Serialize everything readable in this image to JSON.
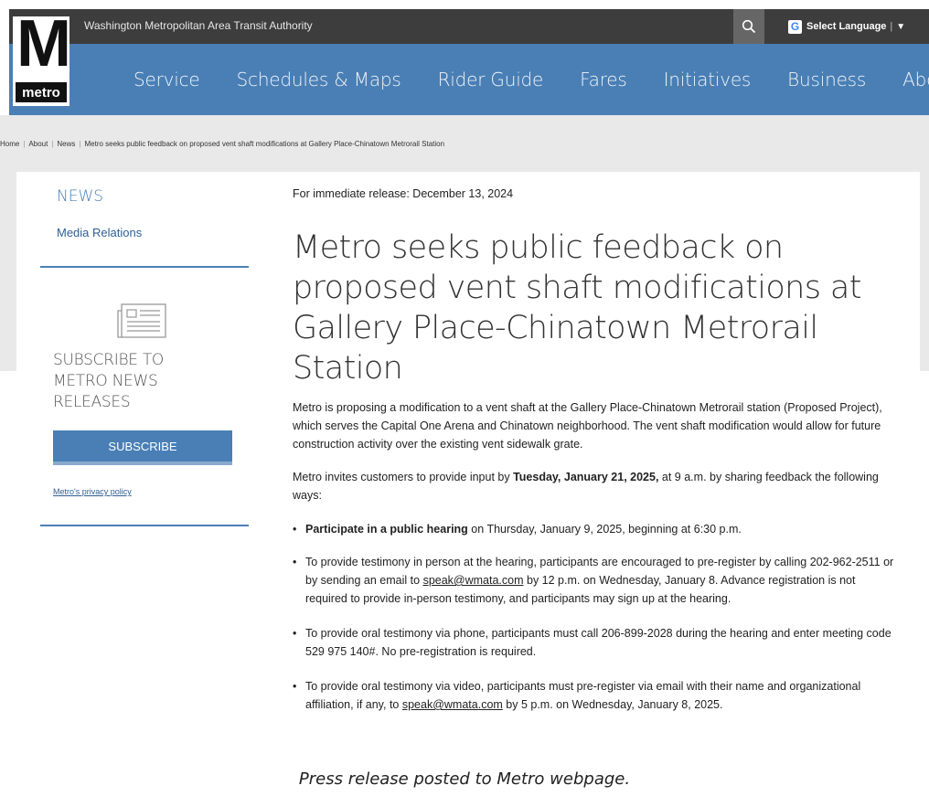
{
  "header": {
    "org_name": "Washington Metropolitan Area Transit Authority",
    "search_icon": "search-icon",
    "language_label": "Select Language",
    "language_separator": "|",
    "language_caret": "▼",
    "google_icon": "google-translate-icon",
    "logo": {
      "letter": "M",
      "word": "metro"
    }
  },
  "nav": {
    "items": [
      "Service",
      "Schedules & Maps",
      "Rider Guide",
      "Fares",
      "Initiatives",
      "Business",
      "About"
    ]
  },
  "breadcrumb": [
    "Home",
    "About",
    "News",
    "Metro seeks public feedback on proposed vent shaft modifications at Gallery Place-Chinatown Metrorail Station"
  ],
  "sidebar": {
    "heading": "NEWS",
    "media_link": "Media Relations",
    "news_icon": "newspaper-icon",
    "subscribe_heading": "SUBSCRIBE TO METRO NEWS RELEASES",
    "subscribe_button": "SUBSCRIBE",
    "privacy_link": "Metro's privacy policy"
  },
  "article": {
    "release_date": "For immediate release: December 13, 2024",
    "headline": "Metro seeks public feedback on proposed vent shaft modifications at Gallery Place-Chinatown Metrorail Station",
    "para1": "Metro is proposing a modification to a vent shaft at the Gallery Place-Chinatown Metrorail station (Proposed Project), which serves the Capital One Arena and Chinatown neighborhood. The vent shaft modification would allow for future construction activity over the existing vent sidewalk grate.",
    "para2_before": "Metro invites customers to provide input by ",
    "para2_bold": "Tuesday, January 21, 2025,",
    "para2_after": " at 9 a.m. by sharing feedback the following ways:",
    "bullet1_bold": "Participate in a public hearing",
    "bullet1_rest": " on Thursday, January 9, 2025, beginning at 6:30 p.m.",
    "bullet2_before": "To provide testimony in person at the hearing, participants are encouraged to pre-register by calling 202-962-2511 or by sending an email to ",
    "bullet2_link": "speak@wmata.com",
    "bullet2_after": " by 12 p.m. on Wednesday, January 8. Advance registration is not required to provide in-person testimony, and participants may sign up at the hearing.",
    "bullet3": "To provide oral testimony via phone, participants must call 206-899-2028 during the hearing and enter meeting code 529 975 140#. No pre-registration is required.",
    "bullet4_before": "To provide oral testimony via video, participants must pre-register via email with their name and organizational affiliation, if any, to ",
    "bullet4_link": "speak@wmata.com",
    "bullet4_after": " by 5 p.m. on Wednesday, January 8, 2025."
  },
  "caption": "Press release posted to Metro webpage.",
  "colors": {
    "topbar": "#3d3d3d",
    "navbar": "#4a7fb5",
    "accent": "#4a7fb5",
    "link": "#2f5f93"
  }
}
